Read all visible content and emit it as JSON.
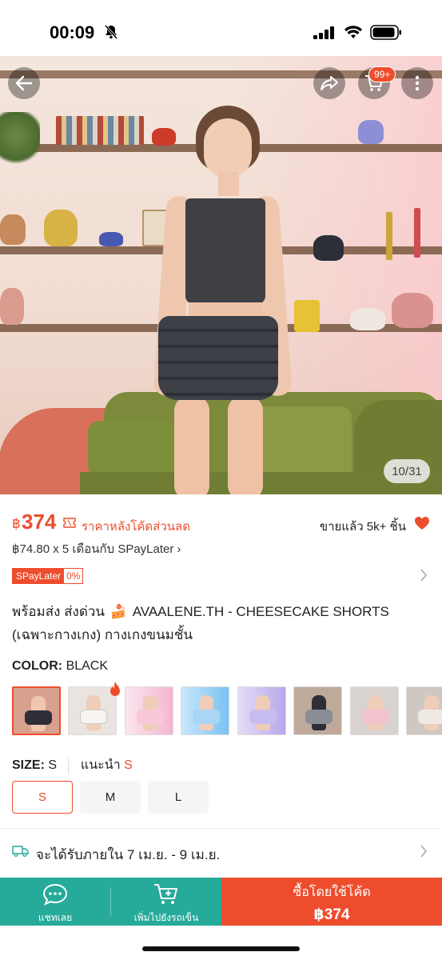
{
  "status_bar": {
    "time": "00:09"
  },
  "hero": {
    "image_counter": "10/31",
    "cart_badge": "99+"
  },
  "price": {
    "currency": "฿",
    "amount": "374",
    "discount_label": "ราคาหลังโค้ดส่วนลด",
    "sold": "ขายแล้ว 5k+ ชิ้น",
    "installment": "฿74.80 x 5 เดือนกับ SPayLater"
  },
  "spaylater": {
    "name": "SPayLater",
    "rate": "0%"
  },
  "product": {
    "title_prefix": "พร้อมส่ง ส่งด่วน",
    "title_emoji": "🍰",
    "title_main": "AVAALENE.TH - CHEESECAKE SHORTS (เฉพาะกางเกง) กางเกงขนมชั้น"
  },
  "color": {
    "label": "COLOR:",
    "value": "BLACK"
  },
  "size": {
    "label": "SIZE:",
    "value": "S",
    "recommend_label": "แนะนำ",
    "recommend_value": "S",
    "options": [
      "S",
      "M",
      "L"
    ]
  },
  "delivery": {
    "text": "จะได้รับภายใน 7 เม.ย. - 9 เม.ย."
  },
  "bottom_bar": {
    "chat_label": "แชทเลย",
    "cart_label": "เพิ่มไปยังรถเข็น",
    "buy_label": "ซื้อโดยใช้โค้ด",
    "buy_price": "฿374"
  },
  "colors": {
    "accent": "#ee4d2d",
    "teal": "#26aa99"
  }
}
